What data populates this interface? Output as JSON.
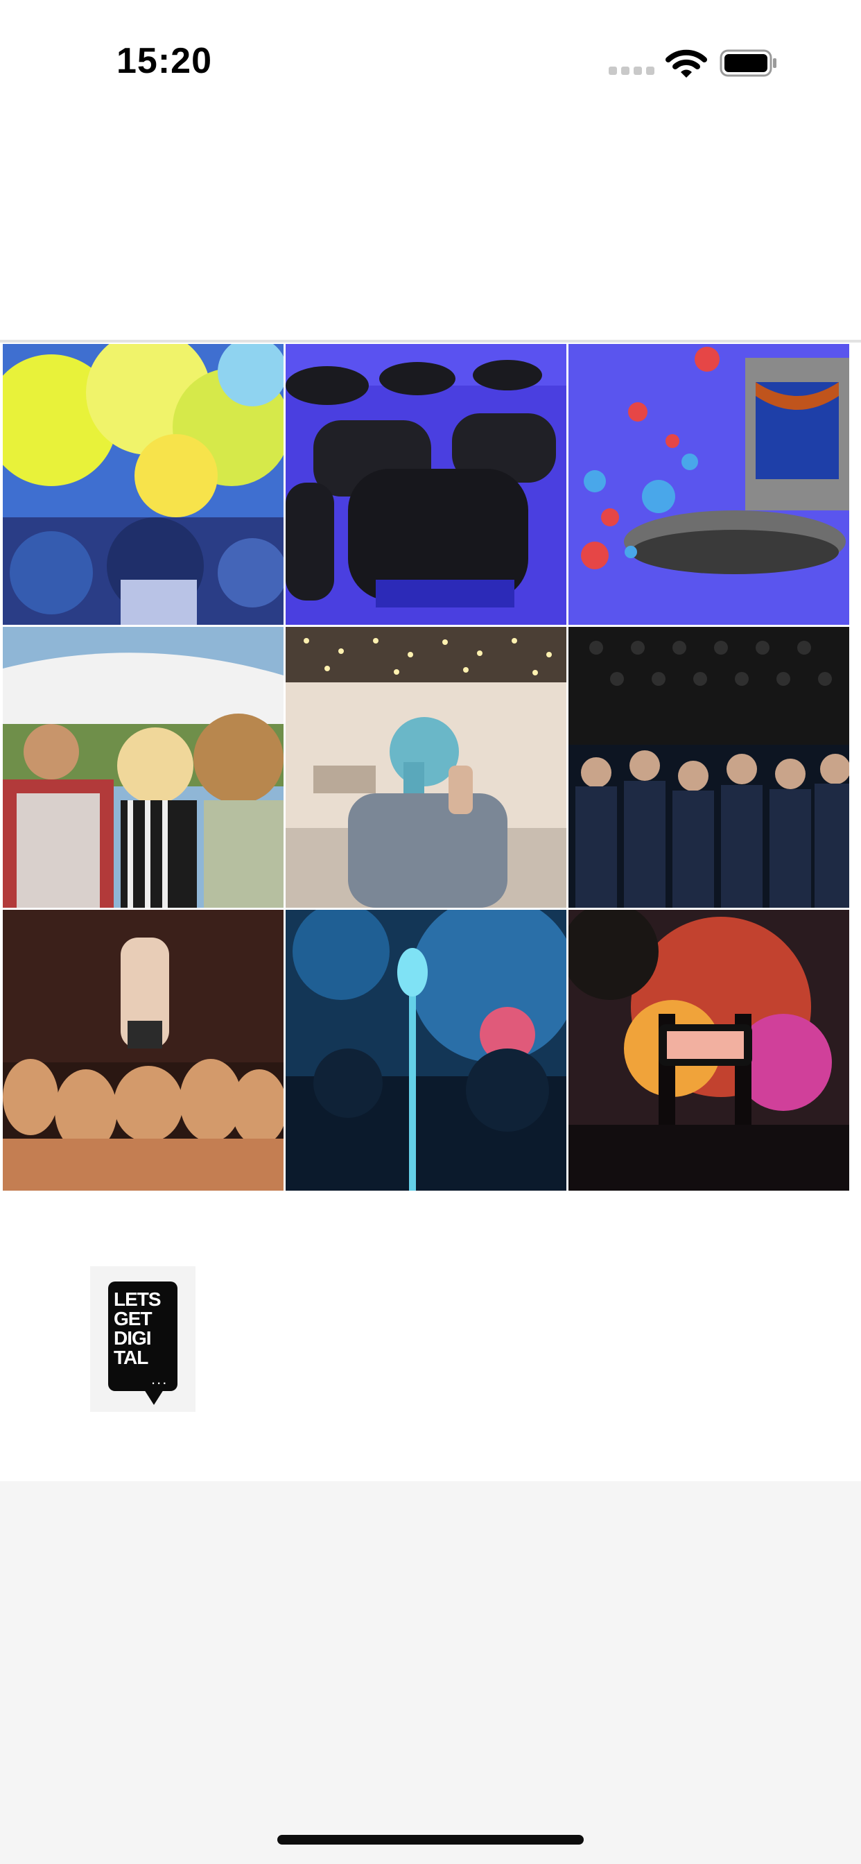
{
  "status_bar": {
    "time": "15:20"
  },
  "logo": {
    "lines": [
      "LETS",
      "GET",
      "DIGI",
      "TAL"
    ],
    "dots": "..."
  },
  "gallery": {
    "tiles": [
      "color-powder-festival-photo",
      "empty-chairs-photo",
      "social-media-stage-illustration",
      "festival-crowd-photo",
      "speaker-on-phone-photo",
      "conference-audience-photo",
      "crowd-surfing-photo",
      "microphone-stage-photo",
      "concert-phone-recording-photo"
    ]
  },
  "colors": {
    "background": "#ffffff",
    "footer_background": "#f5f5f5",
    "divider": "#e2e2e2",
    "text": "#000000"
  }
}
